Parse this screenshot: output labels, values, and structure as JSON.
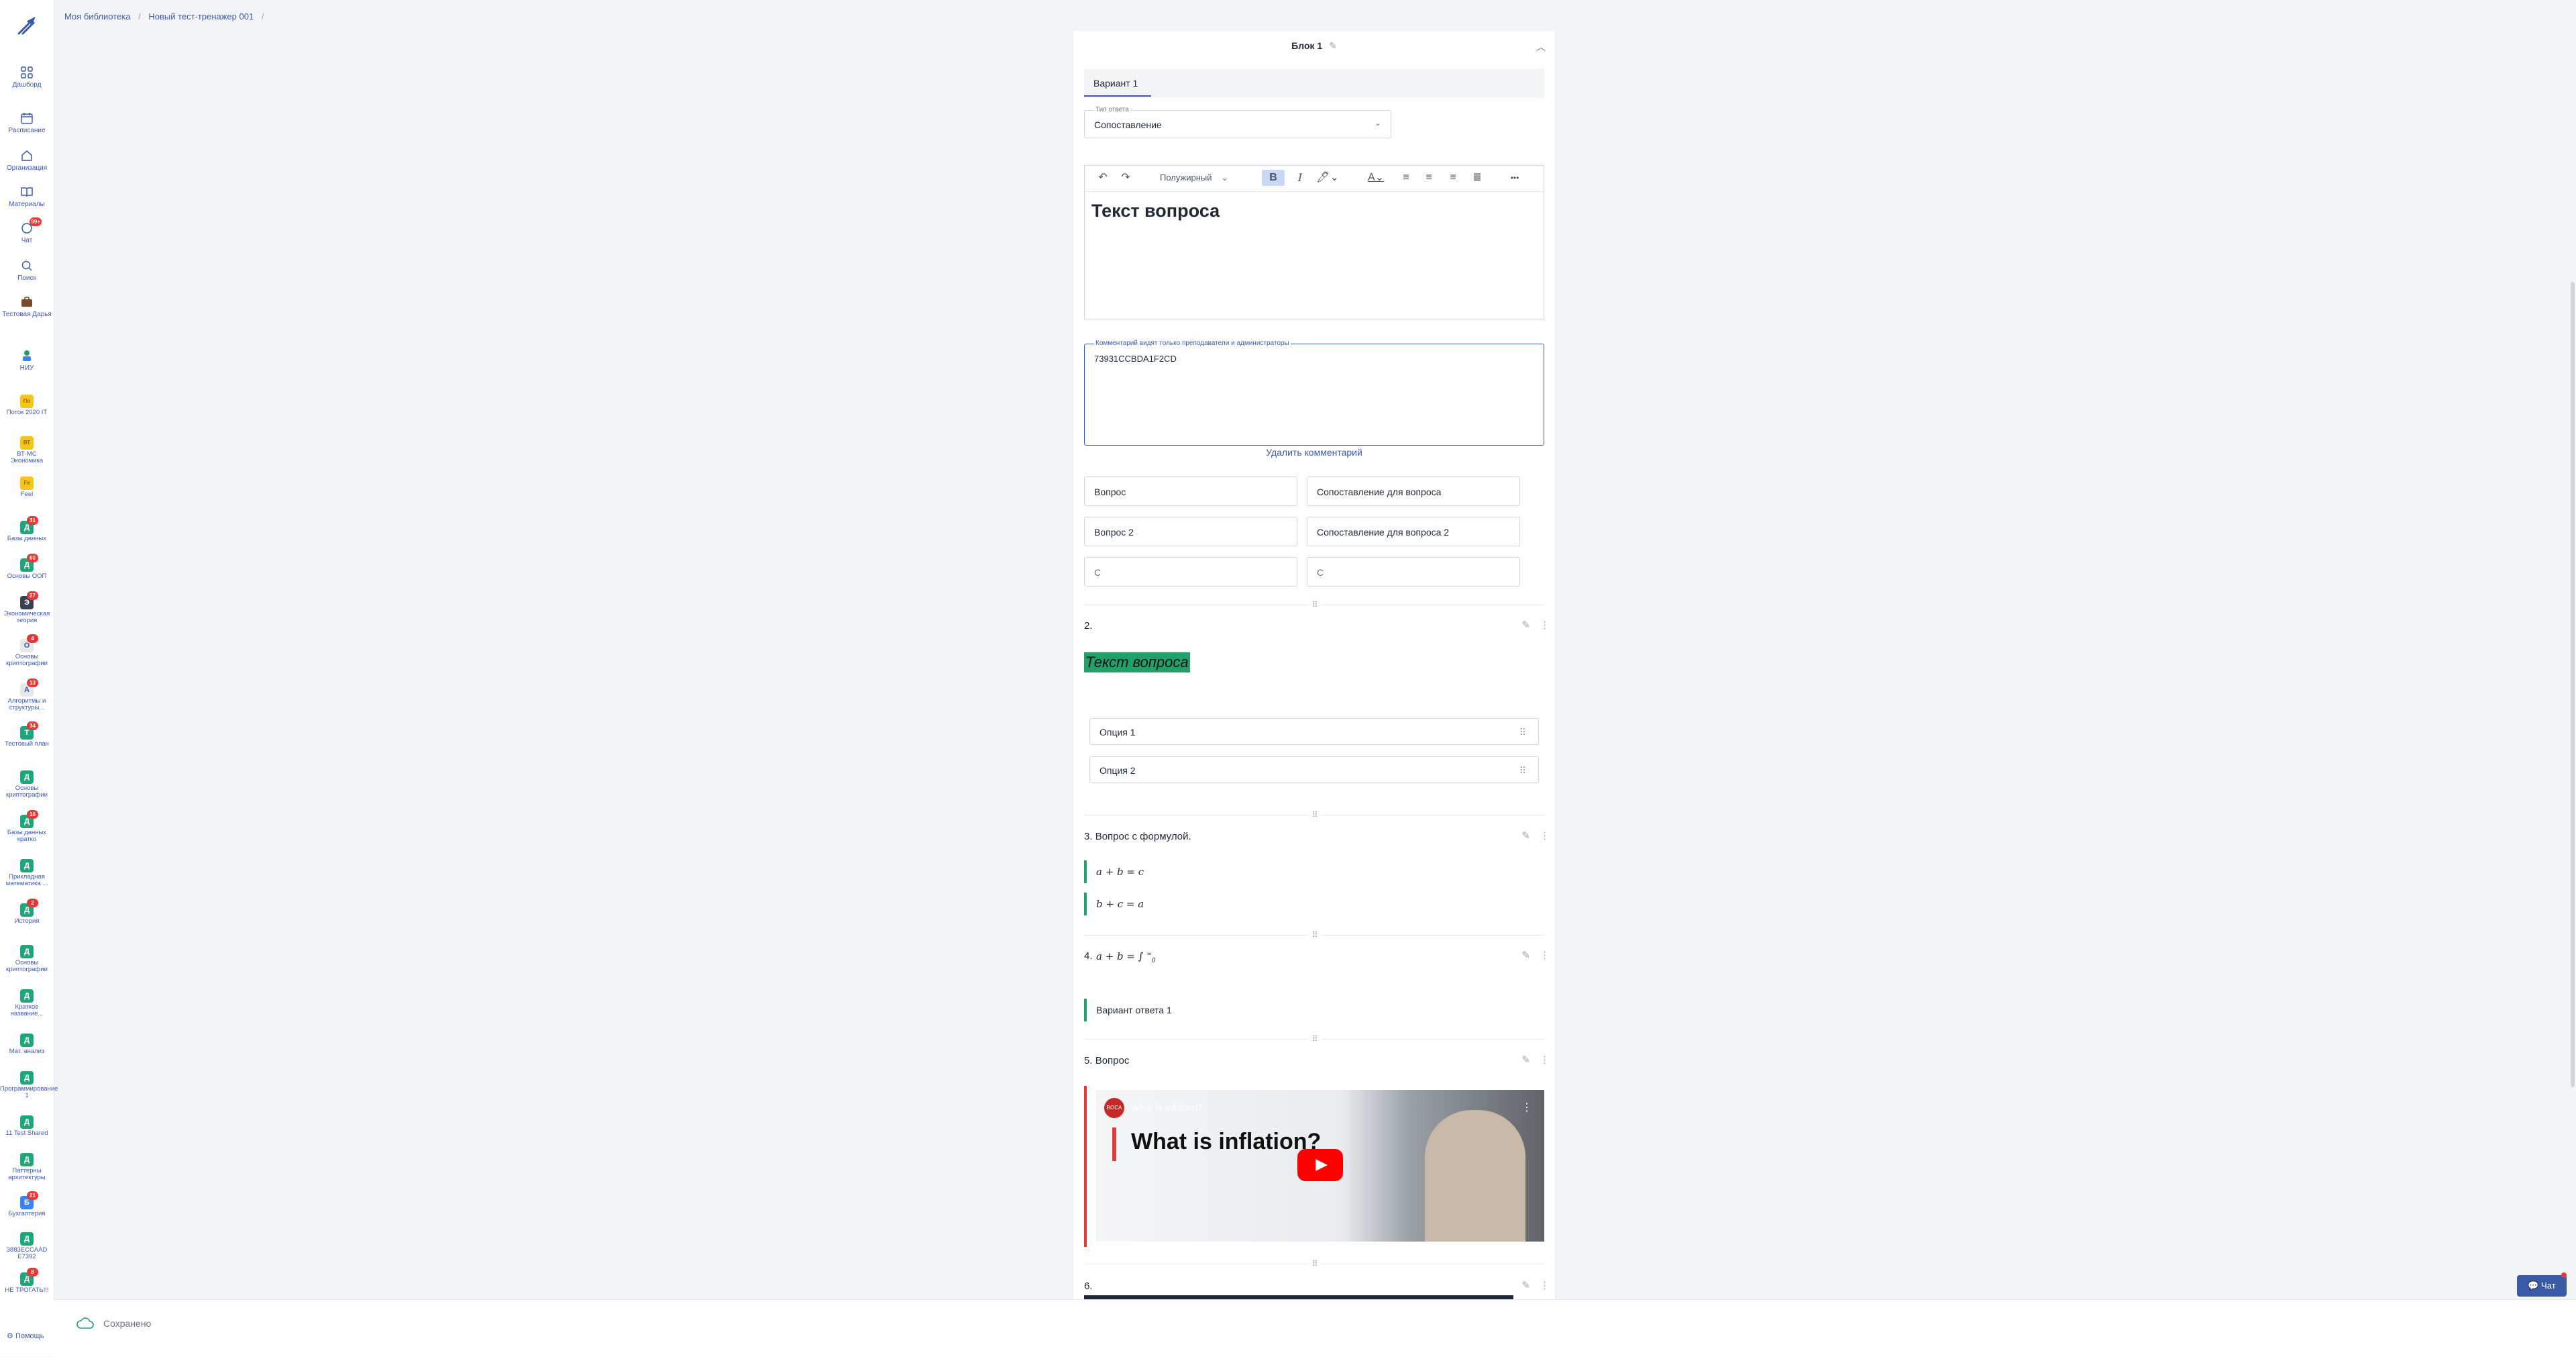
{
  "sidebar": {
    "nav": [
      {
        "label": "Дашборд",
        "icon": "dashboard-icon"
      },
      {
        "label": "Расписание",
        "icon": "calendar-icon"
      },
      {
        "label": "Организация",
        "icon": "home-icon"
      },
      {
        "label": "Материалы",
        "icon": "book-icon"
      },
      {
        "label": "Чат",
        "icon": "chat-icon",
        "badge": "99+"
      },
      {
        "label": "Поиск",
        "icon": "search-icon"
      },
      {
        "label": "Тестовая Дарья",
        "icon": "briefcase-icon"
      },
      {
        "label": "НИУ",
        "icon": "org-icon"
      }
    ],
    "courses": [
      {
        "label": "Поток 2020 IT",
        "letter": "По",
        "color": "#f5c518",
        "badge": ""
      },
      {
        "label": "ВТ-МС Экономика",
        "letter": "ВТ",
        "color": "#f5c518",
        "badge": ""
      },
      {
        "label": "Feel",
        "letter": "Fe",
        "color": "#f5c518",
        "badge": ""
      },
      {
        "label": "Базы данных",
        "letter": "Д",
        "color": "#1fa67a",
        "badge": "31"
      },
      {
        "label": "Основы ООП",
        "letter": "Д",
        "color": "#1fa67a",
        "badge": "60"
      },
      {
        "label": "Экономическая теория",
        "letter": "Э",
        "color": "#374151",
        "badge": "27"
      },
      {
        "label": "Основы криптографии",
        "letter": "О",
        "color": "#e5e7eb",
        "badge": "4"
      },
      {
        "label": "Алгоритмы и структуры...",
        "letter": "А",
        "color": "#e5e7eb",
        "badge": "13"
      },
      {
        "label": "Тестовый план",
        "letter": "Т",
        "color": "#1fa67a",
        "badge": "34"
      },
      {
        "label": "Основы криптографии",
        "letter": "Д",
        "color": "#1fa67a",
        "badge": ""
      },
      {
        "label": "Базы данных кратко",
        "letter": "Д",
        "color": "#1fa67a",
        "badge": "16"
      },
      {
        "label": "Прикладная математика ...",
        "letter": "Д",
        "color": "#1fa67a",
        "badge": ""
      },
      {
        "label": "История",
        "letter": "Д",
        "color": "#1fa67a",
        "badge": "2"
      },
      {
        "label": "Основы криптографии",
        "letter": "Д",
        "color": "#1fa67a",
        "badge": ""
      },
      {
        "label": "Краткое название...",
        "letter": "Д",
        "color": "#1fa67a",
        "badge": ""
      },
      {
        "label": "Мат. анализ",
        "letter": "Д",
        "color": "#1fa67a",
        "badge": ""
      },
      {
        "label": "Программирование 1",
        "letter": "Д",
        "color": "#1fa67a",
        "badge": ""
      },
      {
        "label": "11 Test Shared",
        "letter": "Д",
        "color": "#1fa67a",
        "badge": ""
      },
      {
        "label": "Паттерны архитектуры",
        "letter": "Д",
        "color": "#1fa67a",
        "badge": ""
      },
      {
        "label": "Бухгалтерия",
        "letter": "Б",
        "color": "#3b82f6",
        "badge": "21"
      },
      {
        "label": "3883ECCAAD E7392",
        "letter": "Д",
        "color": "#1fa67a",
        "badge": ""
      },
      {
        "label": "НЕ ТРОГАТЬ!!!",
        "letter": "Д",
        "color": "#1fa67a",
        "badge": "8"
      }
    ],
    "help": "Помощь"
  },
  "breadcrumb": {
    "items": [
      "Моя библиотека",
      "Новый тест-тренажер 001"
    ],
    "separator": "/"
  },
  "block": {
    "title": "Блок 1",
    "variant_tab": "Вариант 1",
    "answer_type_label": "Тип ответа",
    "answer_type_value": "Сопоставление",
    "editor": {
      "font_select": "Полужирный",
      "bold": "B",
      "italic": "I",
      "more": "•••",
      "content": "Текст вопроса"
    },
    "comment": {
      "label": "Комментарий видят только преподаватели и администраторы",
      "value": "73931CCBDA1F2CD",
      "delete": "Удалить комментарий"
    },
    "pairs": [
      {
        "left": "Вопрос",
        "right": "Сопоставление для вопроса",
        "placeholder": false
      },
      {
        "left": "Вопрос 2",
        "right": "Сопоставление для вопроса 2",
        "placeholder": false
      },
      {
        "left": "С",
        "right": "С",
        "placeholder": true
      }
    ]
  },
  "questions": {
    "q2": {
      "num": "2.",
      "text": "Текст вопроса",
      "options": [
        "Опция 1",
        "Опция 2"
      ]
    },
    "q3": {
      "num": "3.",
      "title": "Вопрос с формулой.",
      "formulas": [
        "a + b = c",
        "b + c = a"
      ]
    },
    "q4": {
      "num": "4.",
      "formula": "a + b = ∫",
      "upper": "∞",
      "lower": "0",
      "answer": "Вариант ответа 1"
    },
    "q5": {
      "num": "5.",
      "title": "Вопрос",
      "video_title": "What is inflation?",
      "video_heading": "What is inflation?"
    },
    "q6": {
      "num": "6."
    }
  },
  "footer": {
    "status": "Сохранено"
  },
  "chat_button": "Чат",
  "colors": {
    "accent": "#3b5ba9",
    "green": "#22a06b",
    "red": "#e53935"
  }
}
